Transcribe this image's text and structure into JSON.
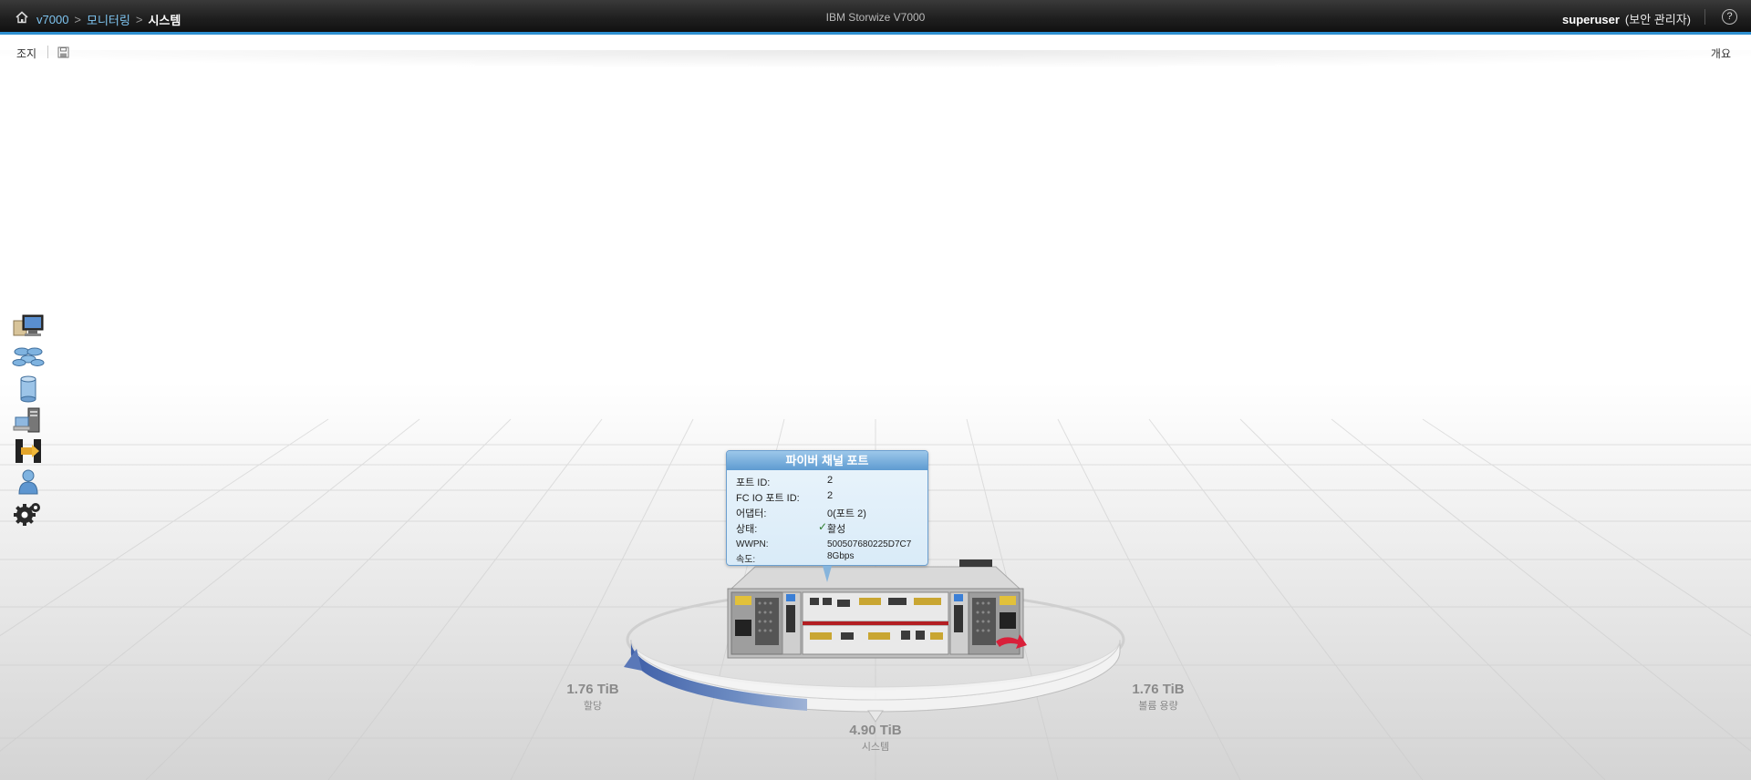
{
  "topbar": {
    "breadcrumb": [
      "v7000",
      "모니터링",
      "시스템"
    ],
    "separator": ">",
    "title": "IBM Storwize V7000",
    "user": "superuser",
    "role": "(보안 관리자)",
    "help": "?"
  },
  "toolbar": {
    "actions_label": "조지",
    "overview_label": "개요"
  },
  "nav": [
    "monitoring-icon",
    "pools-icon",
    "volumes-icon",
    "hosts-icon",
    "copy-services-icon",
    "access-icon",
    "settings-icon"
  ],
  "tooltip": {
    "title": "파이버 채널 포트",
    "rows": [
      {
        "label": "포트 ID:",
        "value": "2"
      },
      {
        "label": "FC IO 포트 ID:",
        "value": "2"
      },
      {
        "label": "어댑터:",
        "value": "0(포트 2)"
      },
      {
        "label": "상태:",
        "value": "활성"
      },
      {
        "label": "WWPN:",
        "value": "500507680225D7C7"
      },
      {
        "label": "속도:",
        "value": "8Gbps"
      }
    ]
  },
  "capacity": {
    "allocated": {
      "value": "1.76 TiB",
      "label": "할당"
    },
    "volume": {
      "value": "1.76 TiB",
      "label": "볼륨 용량"
    },
    "system": {
      "value": "4.90 TiB",
      "label": "시스템"
    }
  },
  "colors": {
    "accent": "#2d8fd0",
    "link": "#7ec4f0",
    "allocated_arc": "#5a78b8",
    "status_ok": "#2c7a2c"
  }
}
